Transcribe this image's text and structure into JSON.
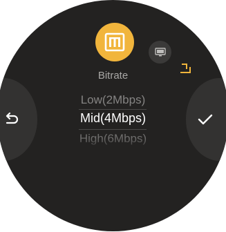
{
  "screen": {
    "title": "Bitrate",
    "options": {
      "prev": "Low(2Mbps)",
      "current": "Mid(4Mbps)",
      "next": "High(6Mbps)"
    }
  },
  "icons": {
    "main": "bitrate-icon",
    "secondary": "monitor-icon",
    "corner": "corner-arrow-icon",
    "back": "back-arrow-icon",
    "confirm": "check-icon"
  },
  "colors": {
    "background": "#232221",
    "accent": "#f1b53c",
    "side_button": "#333231"
  }
}
